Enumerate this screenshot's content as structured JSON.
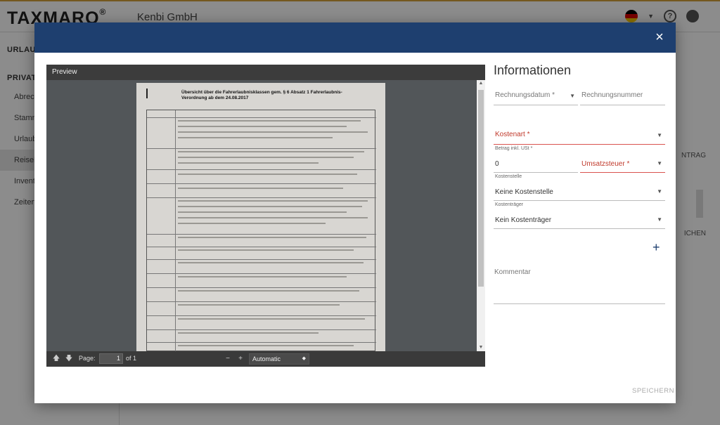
{
  "app": {
    "logo": "TAXMARO",
    "logo_mark": "®",
    "company": "Kenbi GmbH",
    "help_icon": "?",
    "sidebar": {
      "section_top": "URLAUB",
      "section_privat": "PRIVAT",
      "items": [
        "Abrech",
        "Stamm",
        "Urlaub",
        "Reiseko",
        "Invent",
        "Zeiterf"
      ]
    },
    "right_fragments": [
      "NTRAG",
      "ICHEN"
    ]
  },
  "modal": {
    "close": "×",
    "preview": {
      "title": "Preview",
      "page_label": "Page:",
      "page_value": "1",
      "page_of": "of 1",
      "zoom_minus": "−",
      "zoom_plus": "+",
      "zoom_value": "Automatic",
      "doc_title": "Übersicht über die Fahrerlaubnisklassen gem. § 6 Absatz 1 Fahrerlaubnis-Verordnung ab dem 24.08.2017"
    },
    "info": {
      "title": "Informationen",
      "rechnungsdatum": "Rechnungsdatum *",
      "rechnungsnummer": "Rechnungsnummer",
      "kostenart": "Kostenart *",
      "betrag_label": "Betrag inkl. USt *",
      "betrag_value": "0",
      "umsatzsteuer": "Umsatzsteuer *",
      "kostenstelle_label": "Kostenstelle",
      "kostenstelle_value": "Keine Kostenstelle",
      "kostentraeger_label": "Kostenträger",
      "kostentraeger_value": "Kein Kostenträger",
      "add": "+",
      "kommentar": "Kommentar",
      "save": "SPEICHERN"
    }
  }
}
